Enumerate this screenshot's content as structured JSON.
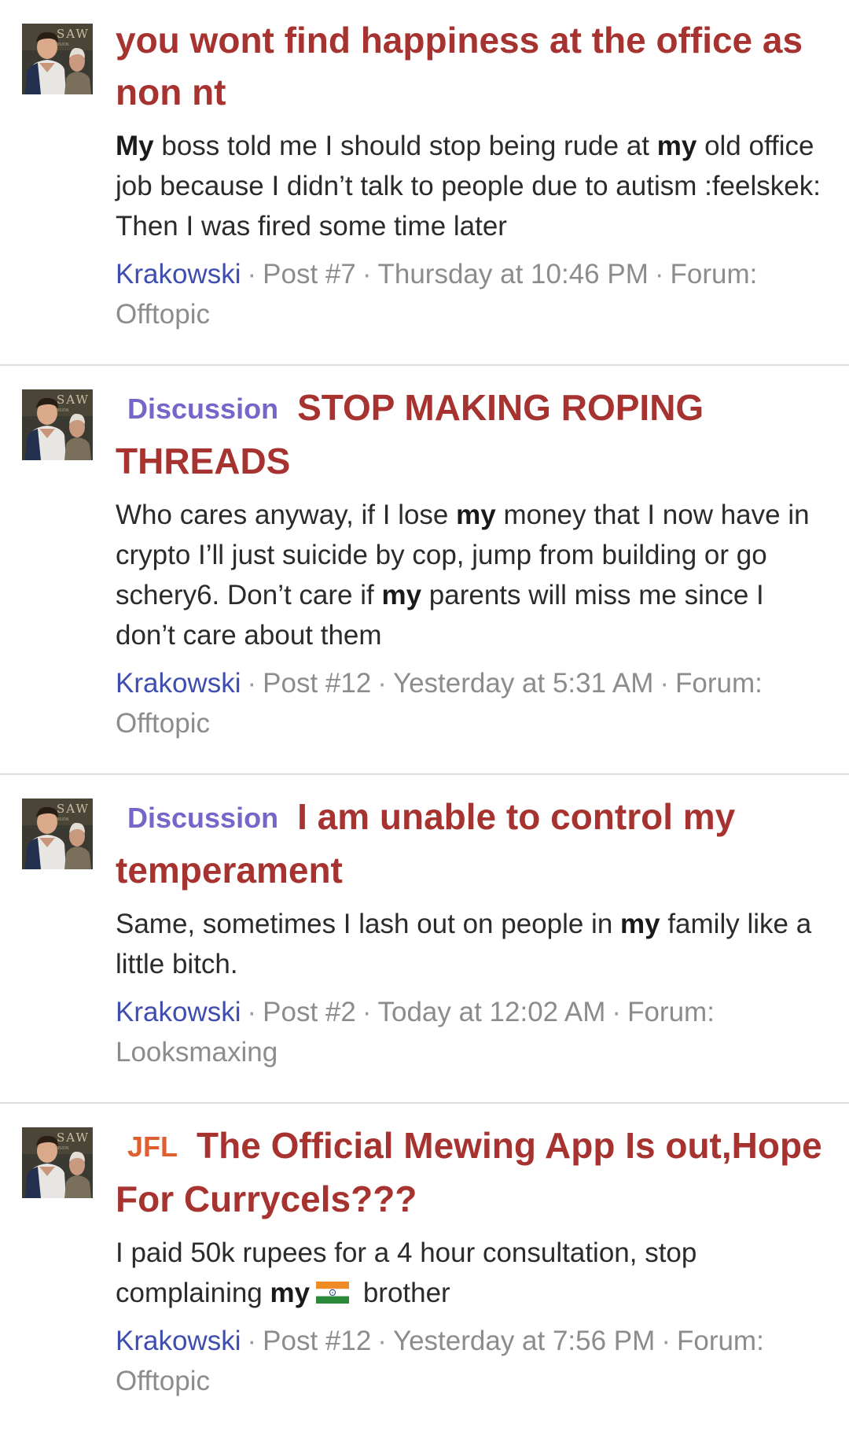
{
  "results": [
    {
      "prefix": "",
      "title": "you wont find happiness at the office as non nt",
      "snippet": {
        "hl1": "My",
        "t1": " boss told me I should stop being rude at ",
        "hl2": "my",
        "t2": " old office job because I didn’t talk to people due to autism :feelskek: Then I was fired some time later"
      },
      "author": "Krakowski",
      "post": "Post #7",
      "date": "Thursday at 10:46 PM",
      "forum_label": "Forum:",
      "forum": "Offtopic"
    },
    {
      "prefix": "Discussion",
      "title": "STOP MAKING ROPING THREADS",
      "snippet": {
        "t1": "Who cares anyway, if I lose ",
        "hl1": "my",
        "t2": " money that I now have in crypto I’ll just suicide by cop, jump from building or go schery6. Don’t care if ",
        "hl2": "my",
        "t3": " parents will miss me since I don’t care about them"
      },
      "author": "Krakowski",
      "post": "Post #12",
      "date": "Yesterday at 5:31 AM",
      "forum_label": "Forum:",
      "forum": "Offtopic"
    },
    {
      "prefix": "Discussion",
      "title_before": "I am unable to control ",
      "title_hl": "my",
      "title_after": " temperament",
      "snippet": {
        "t1": "Same, sometimes I lash out on people in ",
        "hl1": "my",
        "t2": " family like a little bitch."
      },
      "author": "Krakowski",
      "post": "Post #2",
      "date": "Today at 12:02 AM",
      "forum_label": "Forum:",
      "forum": "Looksmaxing"
    },
    {
      "prefix": "JFL",
      "title": "The Official Mewing App Is out,Hope For Currycels???",
      "snippet": {
        "t1": "I paid 50k rupees for a 4 hour consultation, stop complaining ",
        "hl1": "my",
        "emoji": "india-flag-icon",
        "t2": " brother"
      },
      "author": "Krakowski",
      "post": "Post #12",
      "date": "Yesterday at 7:56 PM",
      "forum_label": "Forum:",
      "forum": "Offtopic"
    }
  ],
  "separator": "·",
  "colors": {
    "title": "#a6332f",
    "author": "#3f4db0",
    "prefix_discussion": "#7765c9",
    "prefix_jfl": "#e05f30",
    "meta": "#8c8c8c"
  }
}
